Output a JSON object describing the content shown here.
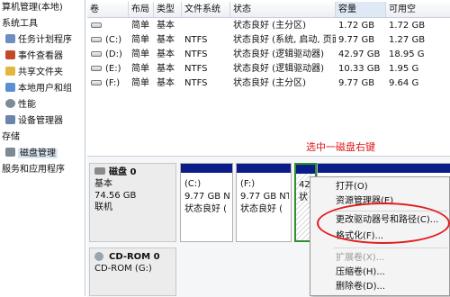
{
  "tree": {
    "title": "算机管理(本地)",
    "section_tools": "系统工具",
    "items_tools": [
      {
        "label": "任务计划程序",
        "icon": "task-scheduler-icon",
        "color": "#6d8fbf"
      },
      {
        "label": "事件查看器",
        "icon": "event-viewer-icon",
        "color": "#c4482b"
      },
      {
        "label": "共享文件夹",
        "icon": "shared-folder-icon",
        "color": "#e3b73d"
      },
      {
        "label": "本地用户和组",
        "icon": "users-icon",
        "color": "#5a8fd1"
      },
      {
        "label": "性能",
        "icon": "performance-icon",
        "color": "#7e8c99"
      },
      {
        "label": "设备管理器",
        "icon": "device-manager-icon",
        "color": "#6b86a8"
      }
    ],
    "section_storage": "存储",
    "disk_mgmt": {
      "label": "磁盘管理",
      "icon": "disk-management-icon",
      "color": "#7c8a95"
    },
    "section_services": "服务和应用程序"
  },
  "volume_table": {
    "headers": [
      "卷",
      "布局",
      "类型",
      "文件系统",
      "状态",
      "容量",
      "可用空"
    ],
    "rows": [
      {
        "volume": "",
        "layout": "简单",
        "type": "基本",
        "fs": "",
        "status": "状态良好 (主分区)",
        "capacity": "1.72 GB",
        "free": "1.72 GB"
      },
      {
        "volume": "(C:)",
        "layout": "简单",
        "type": "基本",
        "fs": "NTFS",
        "status": "状态良好 (系统, 启动, 页面...",
        "capacity": "9.77 GB",
        "free": "1.27 GB"
      },
      {
        "volume": "(D:)",
        "layout": "简单",
        "type": "基本",
        "fs": "NTFS",
        "status": "状态良好 (逻辑驱动器)",
        "capacity": "42.97 GB",
        "free": "18.95 G"
      },
      {
        "volume": "(E:)",
        "layout": "简单",
        "type": "基本",
        "fs": "NTFS",
        "status": "状态良好 (逻辑驱动器)",
        "capacity": "10.33 GB",
        "free": "1.95 G"
      },
      {
        "volume": "(F:)",
        "layout": "简单",
        "type": "基本",
        "fs": "NTFS",
        "status": "状态良好 (主分区)",
        "capacity": "9.77 GB",
        "free": "9.64 G"
      }
    ]
  },
  "disks": [
    {
      "name": "磁盘 0",
      "kind": "基本",
      "size": "74.56 GB",
      "state": "联机"
    },
    {
      "name": "CD-ROM 0",
      "kind": "CD-ROM (G:)",
      "size": "",
      "state": ""
    }
  ],
  "partitions": [
    {
      "drive": "(C:)",
      "size": "9.77 GB NT",
      "status": "状态良好 ("
    },
    {
      "drive": "(F:)",
      "size": "9.77 GB NT",
      "status": "状态良好 ("
    },
    {
      "drive": "",
      "size": "42",
      "status": "状"
    }
  ],
  "annotation": "选中一磁盘右键",
  "context_menu": {
    "items": [
      "打开(O)",
      "资源管理器(E)",
      "更改驱动器号和路径(C)...",
      "格式化(F)...",
      "扩展卷(X)...",
      "压缩卷(H)...",
      "删除卷(D)..."
    ]
  },
  "colors": {
    "partition_bar": "#0b1b87",
    "highlight_ring": "#e11c1c",
    "annotation": "#e01515",
    "selected_partition": "#2f8f2f"
  }
}
